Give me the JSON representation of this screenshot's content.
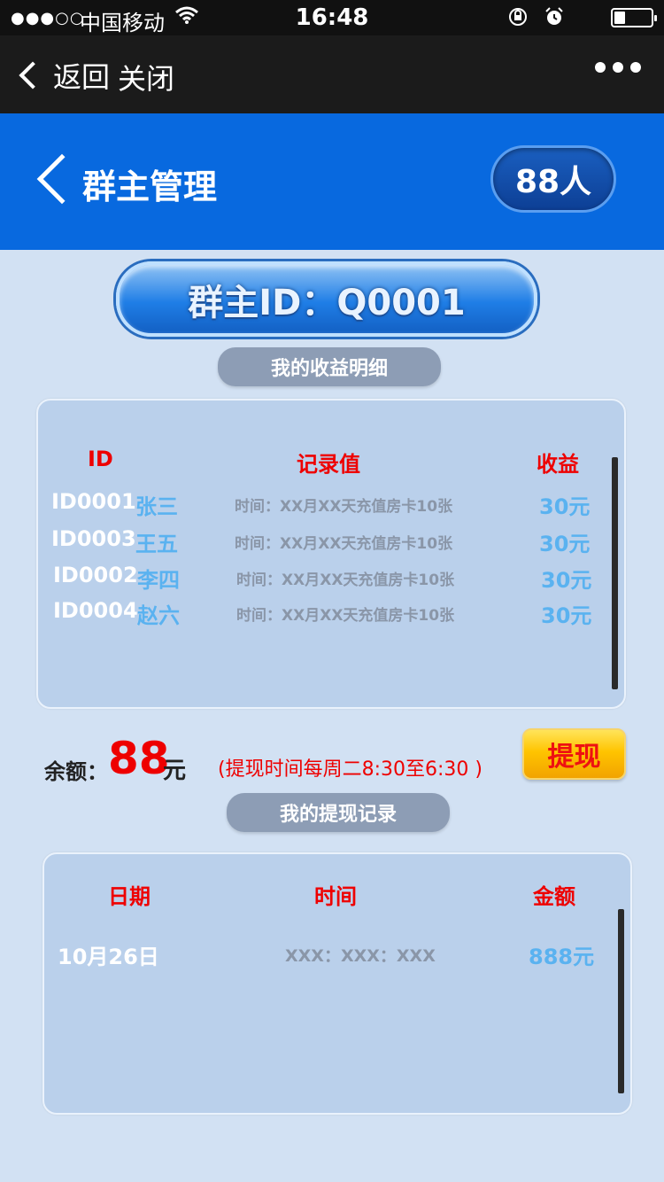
{
  "status_bar": {
    "signal": "●●●○○",
    "carrier": "中国移动",
    "time": "16:48"
  },
  "nav": {
    "back_label": "返回",
    "close_label": "关闭"
  },
  "header": {
    "title": "群主管理",
    "member_count": "88人"
  },
  "owner": {
    "banner": "群主ID：Q0001"
  },
  "income": {
    "section_title": "我的收益明细",
    "columns": {
      "id": "ID",
      "record": "记录值",
      "income": "收益"
    },
    "rows": [
      {
        "id": "ID0001",
        "name": "张三",
        "record": "时间：XX月XX天充值房卡10张",
        "amount": "30元"
      },
      {
        "id": "ID0003",
        "name": "王五",
        "record": "时间：XX月XX天充值房卡10张",
        "amount": "30元"
      },
      {
        "id": "ID0002",
        "name": "李四",
        "record": "时间：XX月XX天充值房卡10张",
        "amount": "30元"
      },
      {
        "id": "ID0004",
        "name": "赵六",
        "record": "时间：XX月XX天充值房卡10张",
        "amount": "30元"
      }
    ]
  },
  "balance": {
    "label": "余额：",
    "value": "88",
    "unit": "元",
    "note": "(提现时间每周二8:30至6:30 )",
    "withdraw_button": "提现"
  },
  "withdrawals": {
    "section_title": "我的提现记录",
    "columns": {
      "date": "日期",
      "time": "时间",
      "amount": "金额"
    },
    "rows": [
      {
        "date": "10月26日",
        "time": "XXX：XXX：XXX",
        "amount": "888元"
      }
    ]
  }
}
